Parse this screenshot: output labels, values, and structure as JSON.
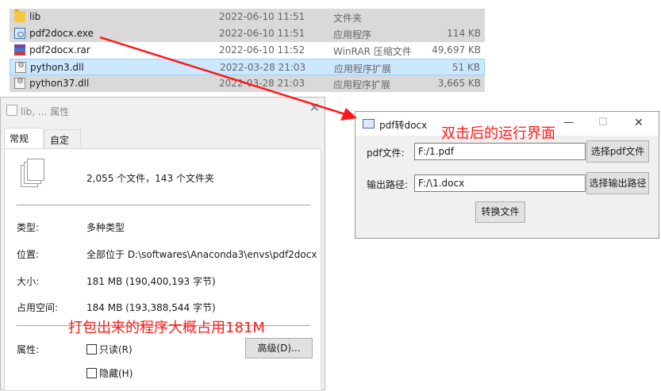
{
  "files": [
    {
      "name": "lib",
      "date": "2022-06-10 11:51",
      "type": "文件夹",
      "size": "",
      "icon": "folder-icon",
      "selection": "grey"
    },
    {
      "name": "pdf2docx.exe",
      "date": "2022-06-10 11:51",
      "type": "应用程序",
      "size": "114 KB",
      "icon": "exe-icon",
      "selection": "grey"
    },
    {
      "name": "pdf2docx.rar",
      "date": "2022-06-10 11:52",
      "type": "WinRAR 压缩文件",
      "size": "49,697 KB",
      "icon": "rar-icon",
      "selection": "none"
    },
    {
      "name": "python3.dll",
      "date": "2022-03-28 21:03",
      "type": "应用程序扩展",
      "size": "51 KB",
      "icon": "dll-icon",
      "selection": "blue"
    },
    {
      "name": "python37.dll",
      "date": "2022-03-28 21:03",
      "type": "应用程序扩展",
      "size": "3,665 KB",
      "icon": "dll-icon",
      "selection": "grey"
    }
  ],
  "props": {
    "title": "lib, ... 属性",
    "close": "✕",
    "tabs": [
      "常规",
      "自定义"
    ],
    "summary": "2,055 个文件，143 个文件夹",
    "rows": [
      {
        "label": "类型:",
        "value": "多种类型"
      },
      {
        "label": "位置:",
        "value": "全部位于 D:\\softwares\\Anaconda3\\envs\\pdf2docx"
      },
      {
        "label": "大小:",
        "value": "181 MB (190,400,193 字节)"
      },
      {
        "label": "占用空间:",
        "value": "184 MB (193,388,544 字节)"
      }
    ],
    "attr_label": "属性:",
    "readonly": "只读(R)",
    "hidden": "隐藏(H)",
    "advanced": "高级(D)..."
  },
  "app": {
    "title": "pdf转docx",
    "minimize": "—",
    "maximize": "☐",
    "close": "✕",
    "pdf_label": "pdf文件:",
    "pdf_value": "F:/1.pdf",
    "pdf_button": "选择pdf文件",
    "out_label": "输出路径:",
    "out_value": "F:/\\1.docx",
    "out_button": "选择输出路径",
    "convert_button": "转换文件"
  },
  "annotations": {
    "run_ui": "双击后的运行界面",
    "size_note": "打包出来的程序大概占用181M",
    "color": "#ff1a1a"
  }
}
